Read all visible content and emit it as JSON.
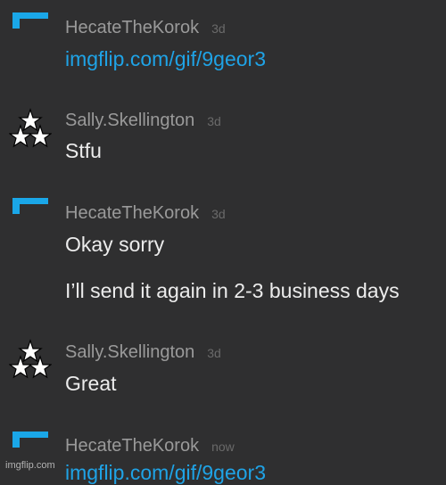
{
  "messages": [
    {
      "user": "HecateTheKorok",
      "time": "3d",
      "lines": [
        "imgflip.com/gif/9geor3"
      ],
      "link": true
    },
    {
      "user": "Sally.Skellington",
      "time": "3d",
      "lines": [
        "Stfu"
      ],
      "link": false
    },
    {
      "user": "HecateTheKorok",
      "time": "3d",
      "lines": [
        "Okay sorry",
        "I’ll send it again in 2-3 business days"
      ],
      "link": false
    },
    {
      "user": "Sally.Skellington",
      "time": "3d",
      "lines": [
        "Great"
      ],
      "link": false
    },
    {
      "user": "HecateTheKorok",
      "time": "now",
      "lines": [
        "imgflip.com/gif/9geor3"
      ],
      "link": true
    }
  ],
  "watermark": "imgflip.com",
  "colors": {
    "background": "#2f2f30",
    "username": "#9a9a9a",
    "timestamp": "#6a6a6a",
    "message_text": "#ececec",
    "link": "#1fa3e6",
    "korok_avatar": "#1aa7e8",
    "sally_avatar": "#ffffff"
  },
  "icons": {
    "hecate_avatar": "blue-corner-flag-icon",
    "sally_avatar": "three-stars-icon"
  }
}
